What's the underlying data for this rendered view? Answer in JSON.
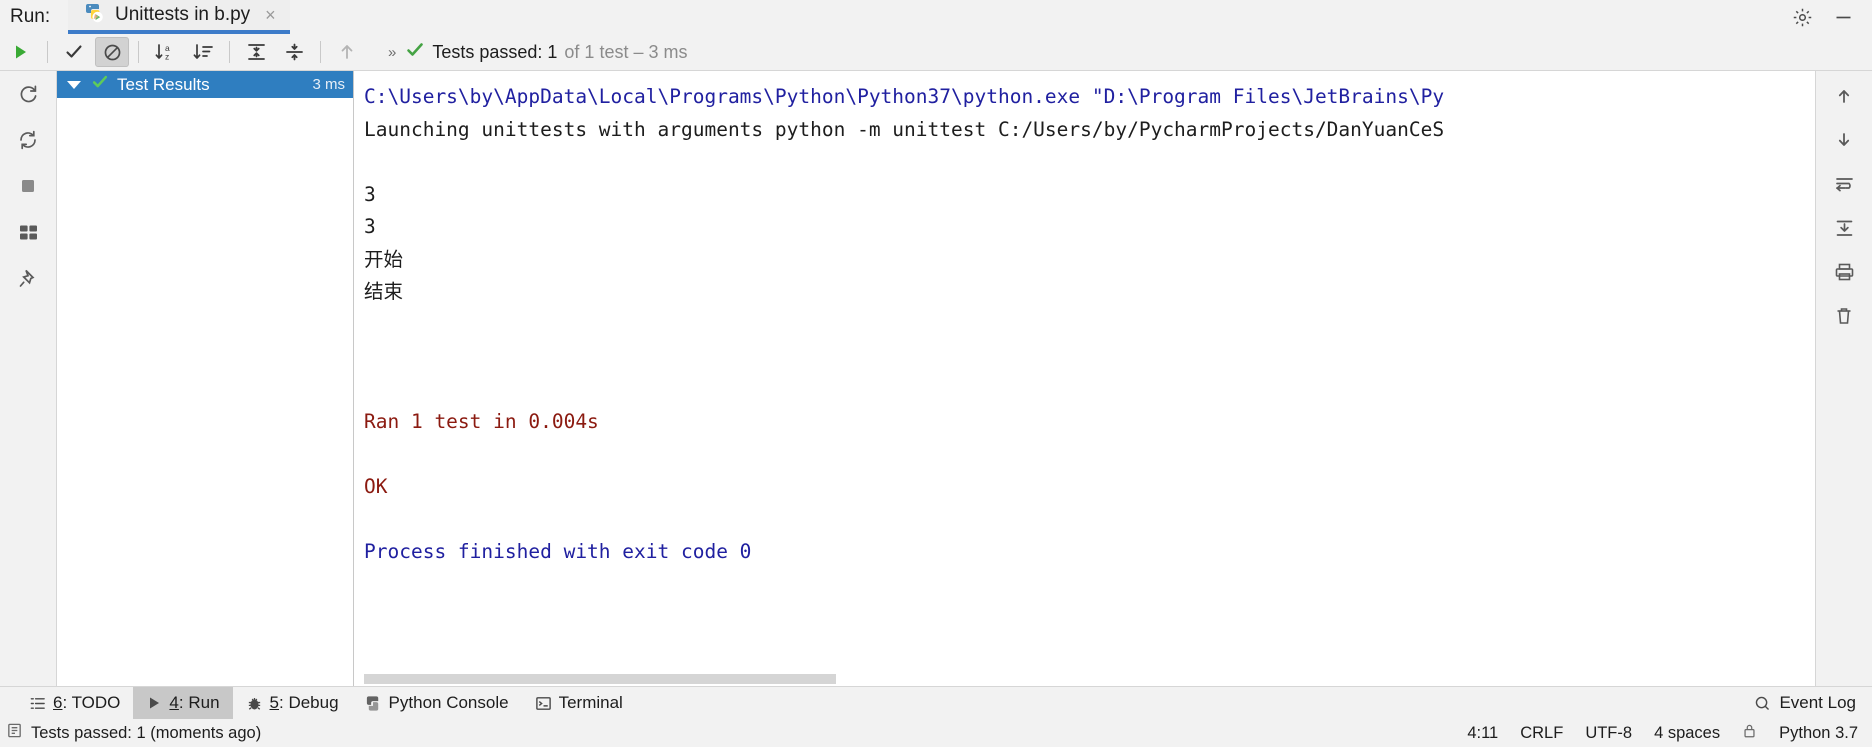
{
  "window": {
    "run_label": "Run:",
    "gear_icon": "gear-icon",
    "minimize_icon": "minimize-icon"
  },
  "tab": {
    "label": "Unittests in b.py",
    "icon": "python-test-icon",
    "close": "×"
  },
  "toolbar": {
    "rerun_icon": "run-green-play-icon",
    "show_passed_icon": "checkmark-icon",
    "show_ignored_icon": "circle-slash-icon",
    "sort_alpha_icon": "sort-alphabetically-icon",
    "sort_duration_icon": "sort-by-duration-icon",
    "expand_all_icon": "expand-all-icon",
    "collapse_all_icon": "collapse-all-icon",
    "prev_icon": "arrow-up-icon",
    "overflow": "»",
    "status_check_icon": "green-check-icon",
    "status_main": "Tests passed: 1",
    "status_dim": "of 1 test – 3 ms"
  },
  "rail": {
    "items": [
      {
        "name": "rerun-failed-icon",
        "glyph": "↺"
      },
      {
        "name": "toggle-auto-test-icon",
        "glyph": "⟳"
      },
      {
        "name": "stop-icon",
        "glyph": "■"
      },
      {
        "name": "layout-icon",
        "glyph": "⌸"
      },
      {
        "name": "pin-tab-icon",
        "glyph": "✐"
      }
    ]
  },
  "tree": {
    "root": {
      "label": "Test Results",
      "time": "3 ms",
      "expanded": true,
      "status_icon": "green-check-icon"
    }
  },
  "console": {
    "lines": [
      {
        "text": "C:\\Users\\by\\AppData\\Local\\Programs\\Python\\Python37\\python.exe \"D:\\Program Files\\JetBrains\\Py",
        "color": "blue"
      },
      {
        "text": "Launching unittests with arguments python -m unittest C:/Users/by/PycharmProjects/DanYuanCeS",
        "color": "black"
      },
      {
        "text": "",
        "color": "black"
      },
      {
        "text": "3",
        "color": "black"
      },
      {
        "text": "3",
        "color": "black"
      },
      {
        "text": "开始",
        "color": "black"
      },
      {
        "text": "结束",
        "color": "black"
      },
      {
        "text": "",
        "color": "black"
      },
      {
        "text": "",
        "color": "black"
      },
      {
        "text": "",
        "color": "black"
      },
      {
        "text": "Ran 1 test in 0.004s",
        "color": "red"
      },
      {
        "text": "",
        "color": "black"
      },
      {
        "text": "OK",
        "color": "red"
      },
      {
        "text": "",
        "color": "black"
      },
      {
        "text": "Process finished with exit code 0",
        "color": "blue"
      }
    ]
  },
  "console_rail": {
    "items": [
      {
        "name": "scroll-up-icon",
        "glyph": "↑"
      },
      {
        "name": "scroll-down-icon",
        "glyph": "↓"
      },
      {
        "name": "soft-wrap-icon",
        "glyph": "↵"
      },
      {
        "name": "scroll-to-end-icon",
        "glyph": "⇩"
      },
      {
        "name": "print-icon",
        "glyph": "⎙"
      },
      {
        "name": "clear-all-icon",
        "glyph": "🗑"
      }
    ]
  },
  "bottom_bar": {
    "items": [
      {
        "name": "bottom-tab-todo",
        "num": "6",
        "label": ": TODO",
        "icon": "todo-list-icon",
        "active": false
      },
      {
        "name": "bottom-tab-run",
        "num": "4",
        "label": ": Run",
        "icon": "run-play-icon",
        "active": true
      },
      {
        "name": "bottom-tab-debug",
        "num": "5",
        "label": ": Debug",
        "icon": "debug-bug-icon",
        "active": false
      },
      {
        "name": "bottom-tab-python-console",
        "num": "",
        "label": "Python Console",
        "icon": "python-icon",
        "active": false
      },
      {
        "name": "bottom-tab-terminal",
        "num": "",
        "label": "Terminal",
        "icon": "terminal-icon",
        "active": false
      }
    ],
    "event_log": "Event Log",
    "event_log_icon": "event-log-icon"
  },
  "status_bar": {
    "message": "Tests passed: 1 (moments ago)",
    "message_icon": "notification-icon",
    "caret": "4:11",
    "line_separator": "CRLF",
    "encoding": "UTF-8",
    "indent": "4 spaces",
    "interpreter": "Python 3.7",
    "lock_icon": "lock-icon"
  }
}
